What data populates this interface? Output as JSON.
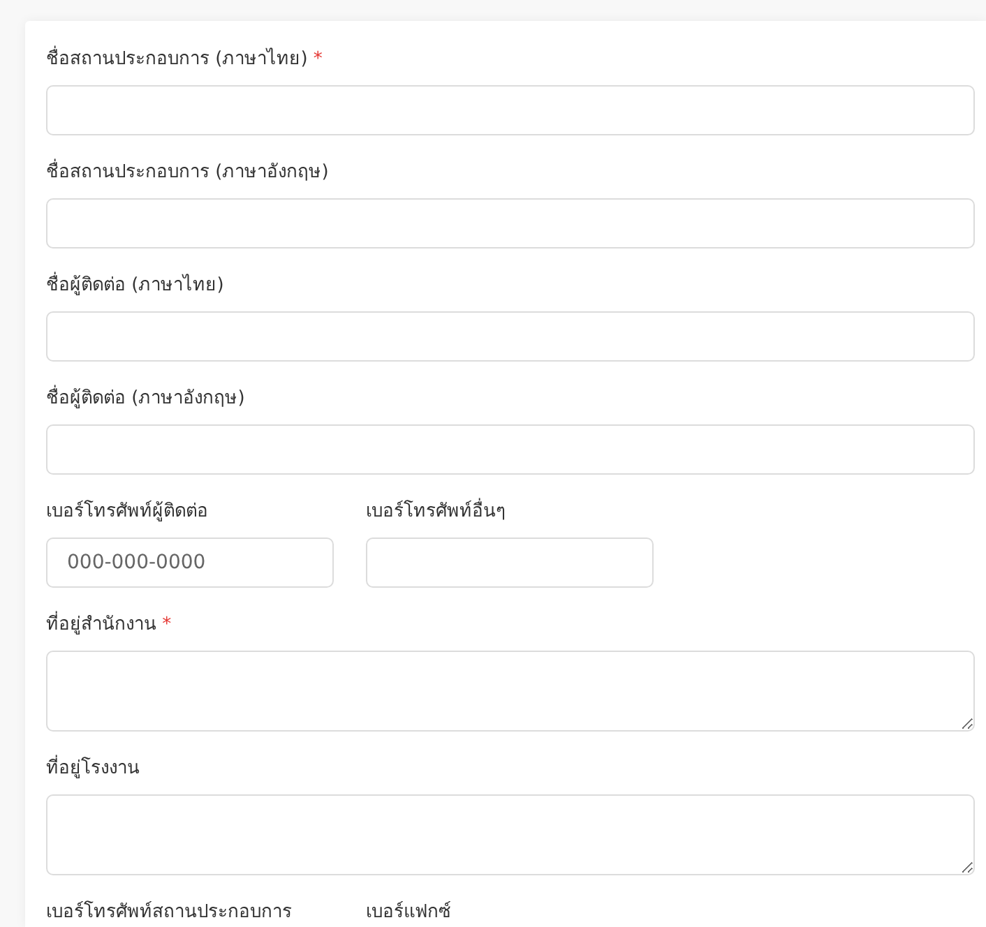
{
  "form": {
    "fields": [
      {
        "kind": "text",
        "items": [
          {
            "label": "ชื่อสถานประกอบการ (ภาษาไทย)",
            "required_mark": "*"
          }
        ]
      },
      {
        "kind": "text",
        "items": [
          {
            "label": "ชื่อสถานประกอบการ (ภาษาอังกฤษ)"
          }
        ]
      },
      {
        "kind": "text",
        "items": [
          {
            "label": "ชื่อผู้ติดต่อ (ภาษาไทย)"
          }
        ]
      },
      {
        "kind": "text",
        "items": [
          {
            "label": "ชื่อผู้ติดต่อ (ภาษาอังกฤษ)"
          }
        ]
      },
      {
        "kind": "pair",
        "items": [
          {
            "label": "เบอร์โทรศัพท์ผู้ติดต่อ",
            "placeholder": "000-000-0000"
          },
          {
            "label": "เบอร์โทรศัพท์อื่นๆ"
          }
        ]
      },
      {
        "kind": "textarea",
        "items": [
          {
            "label": "ที่อยู่สำนักงาน",
            "required_mark": "*"
          }
        ]
      },
      {
        "kind": "textarea",
        "items": [
          {
            "label": "ที่อยู่โรงงาน"
          }
        ]
      },
      {
        "kind": "pair-labels",
        "items": [
          {
            "label": "เบอร์โทรศัพท์สถานประกอบการ"
          },
          {
            "label": "เบอร์แฟกซ์"
          }
        ]
      }
    ]
  }
}
